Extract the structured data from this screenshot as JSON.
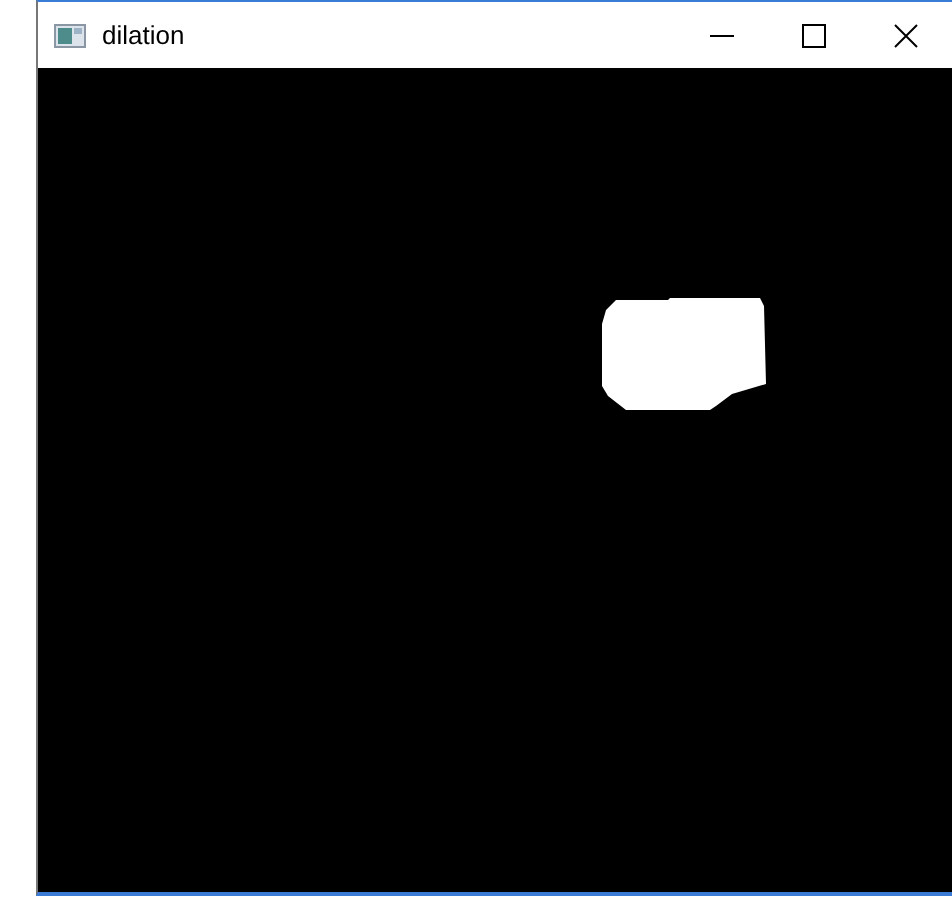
{
  "window": {
    "title": "dilation"
  }
}
